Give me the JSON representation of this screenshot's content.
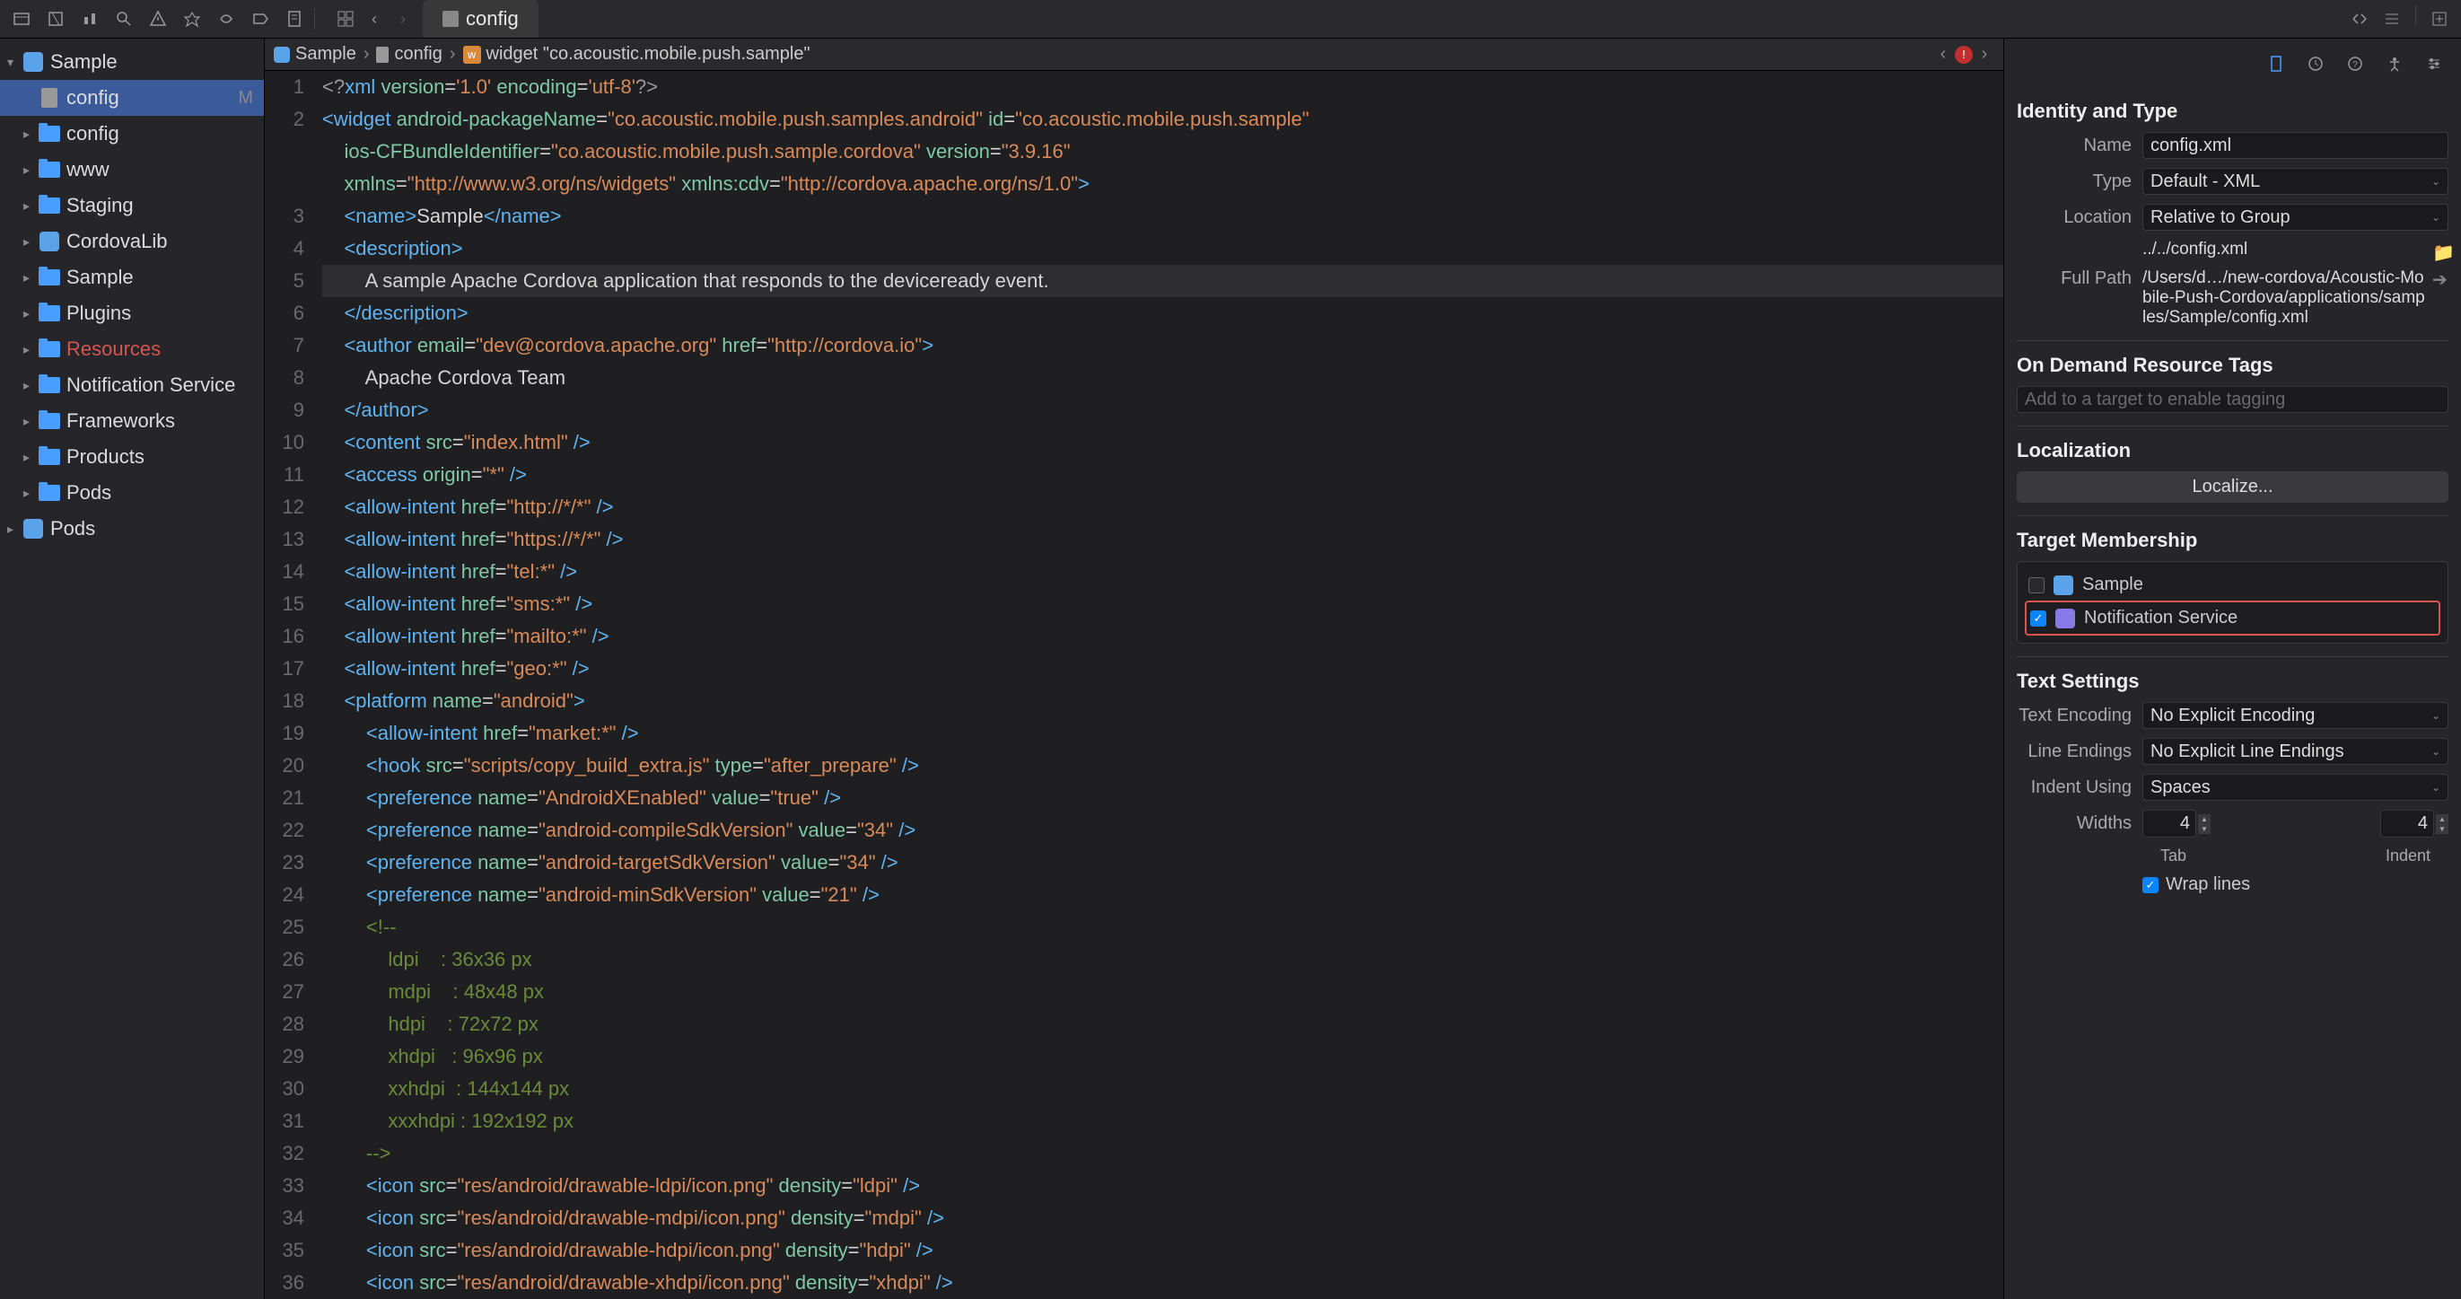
{
  "toolbar": {
    "tab_label": "config"
  },
  "navigator": {
    "root": "Sample",
    "items": [
      {
        "label": "config",
        "type": "file",
        "badge": "M",
        "selected": true,
        "indent": 1
      },
      {
        "label": "config",
        "type": "folder",
        "indent": 1
      },
      {
        "label": "www",
        "type": "folder",
        "indent": 1
      },
      {
        "label": "Staging",
        "type": "folder",
        "indent": 1
      },
      {
        "label": "CordovaLib",
        "type": "app",
        "indent": 1
      },
      {
        "label": "Sample",
        "type": "folder",
        "indent": 1
      },
      {
        "label": "Plugins",
        "type": "folder",
        "indent": 1
      },
      {
        "label": "Resources",
        "type": "folder",
        "indent": 1,
        "red": true
      },
      {
        "label": "Notification Service",
        "type": "folder",
        "indent": 1
      },
      {
        "label": "Frameworks",
        "type": "folder",
        "indent": 1
      },
      {
        "label": "Products",
        "type": "folder",
        "indent": 1
      },
      {
        "label": "Pods",
        "type": "folder",
        "indent": 1
      }
    ],
    "root2": "Pods"
  },
  "breadcrumb": {
    "items": [
      "Sample",
      "config",
      "widget \"co.acoustic.mobile.push.sample\""
    ]
  },
  "code": {
    "lines": [
      {
        "n": 1,
        "html": "<span class='t-pi'>&lt;?</span><span class='t-tag'>xml</span> <span class='t-attr'>version</span>=<span class='t-str'>'1.0'</span> <span class='t-attr'>encoding</span>=<span class='t-str'>'utf-8'</span><span class='t-pi'>?&gt;</span>"
      },
      {
        "n": 2,
        "html": "<span class='t-tag'>&lt;widget</span> <span class='t-attr'>android-packageName</span>=<span class='t-str'>\"co.acoustic.mobile.push.samples.android\"</span> <span class='t-attr'>id</span>=<span class='t-str'>\"co.acoustic.mobile.push.sample\"</span>"
      },
      {
        "n": "",
        "html": "    <span class='t-attr'>ios-CFBundleIdentifier</span>=<span class='t-str'>\"co.acoustic.mobile.push.sample.cordova\"</span> <span class='t-attr'>version</span>=<span class='t-str'>\"3.9.16\"</span>"
      },
      {
        "n": "",
        "html": "    <span class='t-attr'>xmlns</span>=<span class='t-str'>\"http://www.w3.org/ns/widgets\"</span> <span class='t-attr'>xmlns:cdv</span>=<span class='t-str'>\"http://cordova.apache.org/ns/1.0\"</span><span class='t-tag'>&gt;</span>"
      },
      {
        "n": 3,
        "html": "    <span class='t-tag'>&lt;name&gt;</span>Sample<span class='t-tag'>&lt;/name&gt;</span>"
      },
      {
        "n": 4,
        "html": "    <span class='t-tag'>&lt;description&gt;</span>"
      },
      {
        "n": 5,
        "html": "        A sample Apache Cordova application that responds to the deviceready event.",
        "hl": true
      },
      {
        "n": 6,
        "html": "    <span class='t-tag'>&lt;/description&gt;</span>"
      },
      {
        "n": 7,
        "html": "    <span class='t-tag'>&lt;author</span> <span class='t-attr'>email</span>=<span class='t-str'>\"dev@cordova.apache.org\"</span> <span class='t-attr'>href</span>=<span class='t-str'>\"http://cordova.io\"</span><span class='t-tag'>&gt;</span>"
      },
      {
        "n": 8,
        "html": "        Apache Cordova Team"
      },
      {
        "n": 9,
        "html": "    <span class='t-tag'>&lt;/author&gt;</span>"
      },
      {
        "n": 10,
        "html": "    <span class='t-tag'>&lt;content</span> <span class='t-attr'>src</span>=<span class='t-str'>\"index.html\"</span> <span class='t-tag'>/&gt;</span>"
      },
      {
        "n": 11,
        "html": "    <span class='t-tag'>&lt;access</span> <span class='t-attr'>origin</span>=<span class='t-str'>\"*\"</span> <span class='t-tag'>/&gt;</span>"
      },
      {
        "n": 12,
        "html": "    <span class='t-tag'>&lt;allow-intent</span> <span class='t-attr'>href</span>=<span class='t-str'>\"http://*/*\"</span> <span class='t-tag'>/&gt;</span>"
      },
      {
        "n": 13,
        "html": "    <span class='t-tag'>&lt;allow-intent</span> <span class='t-attr'>href</span>=<span class='t-str'>\"https://*/*\"</span> <span class='t-tag'>/&gt;</span>"
      },
      {
        "n": 14,
        "html": "    <span class='t-tag'>&lt;allow-intent</span> <span class='t-attr'>href</span>=<span class='t-str'>\"tel:*\"</span> <span class='t-tag'>/&gt;</span>"
      },
      {
        "n": 15,
        "html": "    <span class='t-tag'>&lt;allow-intent</span> <span class='t-attr'>href</span>=<span class='t-str'>\"sms:*\"</span> <span class='t-tag'>/&gt;</span>"
      },
      {
        "n": 16,
        "html": "    <span class='t-tag'>&lt;allow-intent</span> <span class='t-attr'>href</span>=<span class='t-str'>\"mailto:*\"</span> <span class='t-tag'>/&gt;</span>"
      },
      {
        "n": 17,
        "html": "    <span class='t-tag'>&lt;allow-intent</span> <span class='t-attr'>href</span>=<span class='t-str'>\"geo:*\"</span> <span class='t-tag'>/&gt;</span>"
      },
      {
        "n": 18,
        "html": "    <span class='t-tag'>&lt;platform</span> <span class='t-attr'>name</span>=<span class='t-str'>\"android\"</span><span class='t-tag'>&gt;</span>"
      },
      {
        "n": 19,
        "html": "        <span class='t-tag'>&lt;allow-intent</span> <span class='t-attr'>href</span>=<span class='t-str'>\"market:*\"</span> <span class='t-tag'>/&gt;</span>"
      },
      {
        "n": 20,
        "html": "        <span class='t-tag'>&lt;hook</span> <span class='t-attr'>src</span>=<span class='t-str'>\"scripts/copy_build_extra.js\"</span> <span class='t-attr'>type</span>=<span class='t-str'>\"after_prepare\"</span> <span class='t-tag'>/&gt;</span>"
      },
      {
        "n": 21,
        "html": "        <span class='t-tag'>&lt;preference</span> <span class='t-attr'>name</span>=<span class='t-str'>\"AndroidXEnabled\"</span> <span class='t-attr'>value</span>=<span class='t-str'>\"true\"</span> <span class='t-tag'>/&gt;</span>"
      },
      {
        "n": 22,
        "html": "        <span class='t-tag'>&lt;preference</span> <span class='t-attr'>name</span>=<span class='t-str'>\"android-compileSdkVersion\"</span> <span class='t-attr'>value</span>=<span class='t-str'>\"34\"</span> <span class='t-tag'>/&gt;</span>"
      },
      {
        "n": 23,
        "html": "        <span class='t-tag'>&lt;preference</span> <span class='t-attr'>name</span>=<span class='t-str'>\"android-targetSdkVersion\"</span> <span class='t-attr'>value</span>=<span class='t-str'>\"34\"</span> <span class='t-tag'>/&gt;</span>"
      },
      {
        "n": 24,
        "html": "        <span class='t-tag'>&lt;preference</span> <span class='t-attr'>name</span>=<span class='t-str'>\"android-minSdkVersion\"</span> <span class='t-attr'>value</span>=<span class='t-str'>\"21\"</span> <span class='t-tag'>/&gt;</span>"
      },
      {
        "n": 25,
        "html": "        <span class='t-comment'>&lt;!--</span>"
      },
      {
        "n": 26,
        "html": "<span class='t-comment'>            ldpi    : 36x36 px</span>"
      },
      {
        "n": 27,
        "html": "<span class='t-comment'>            mdpi    : 48x48 px</span>"
      },
      {
        "n": 28,
        "html": "<span class='t-comment'>            hdpi    : 72x72 px</span>"
      },
      {
        "n": 29,
        "html": "<span class='t-comment'>            xhdpi   : 96x96 px</span>"
      },
      {
        "n": 30,
        "html": "<span class='t-comment'>            xxhdpi  : 144x144 px</span>"
      },
      {
        "n": 31,
        "html": "<span class='t-comment'>            xxxhdpi : 192x192 px</span>"
      },
      {
        "n": 32,
        "html": "<span class='t-comment'>        --&gt;</span>"
      },
      {
        "n": 33,
        "html": "        <span class='t-tag'>&lt;icon</span> <span class='t-attr'>src</span>=<span class='t-str'>\"res/android/drawable-ldpi/icon.png\"</span> <span class='t-attr'>density</span>=<span class='t-str'>\"ldpi\"</span> <span class='t-tag'>/&gt;</span>"
      },
      {
        "n": 34,
        "html": "        <span class='t-tag'>&lt;icon</span> <span class='t-attr'>src</span>=<span class='t-str'>\"res/android/drawable-mdpi/icon.png\"</span> <span class='t-attr'>density</span>=<span class='t-str'>\"mdpi\"</span> <span class='t-tag'>/&gt;</span>"
      },
      {
        "n": 35,
        "html": "        <span class='t-tag'>&lt;icon</span> <span class='t-attr'>src</span>=<span class='t-str'>\"res/android/drawable-hdpi/icon.png\"</span> <span class='t-attr'>density</span>=<span class='t-str'>\"hdpi\"</span> <span class='t-tag'>/&gt;</span>"
      },
      {
        "n": 36,
        "html": "        <span class='t-tag'>&lt;icon</span> <span class='t-attr'>src</span>=<span class='t-str'>\"res/android/drawable-xhdpi/icon.png\"</span> <span class='t-attr'>density</span>=<span class='t-str'>\"xhdpi\"</span> <span class='t-tag'>/&gt;</span>"
      }
    ]
  },
  "inspector": {
    "identity_title": "Identity and Type",
    "name_label": "Name",
    "name_value": "config.xml",
    "type_label": "Type",
    "type_value": "Default - XML",
    "location_label": "Location",
    "location_value": "Relative to Group",
    "location_path": "../../config.xml",
    "fullpath_label": "Full Path",
    "fullpath_value": "/Users/d…/new-cordova/Acoustic-Mobile-Push-Cordova/applications/samples/Sample/config.xml",
    "ondemand_title": "On Demand Resource Tags",
    "ondemand_placeholder": "Add to a target to enable tagging",
    "localization_title": "Localization",
    "localize_button": "Localize...",
    "target_title": "Target Membership",
    "targets": [
      {
        "name": "Sample",
        "checked": false,
        "highlighted": false
      },
      {
        "name": "Notification Service",
        "checked": true,
        "highlighted": true
      }
    ],
    "textsettings_title": "Text Settings",
    "encoding_label": "Text Encoding",
    "encoding_value": "No Explicit Encoding",
    "endings_label": "Line Endings",
    "endings_value": "No Explicit Line Endings",
    "indent_label": "Indent Using",
    "indent_value": "Spaces",
    "widths_label": "Widths",
    "tab_width": "4",
    "indent_width": "4",
    "tab_label": "Tab",
    "indent_width_label": "Indent",
    "wrap_label": "Wrap lines"
  }
}
